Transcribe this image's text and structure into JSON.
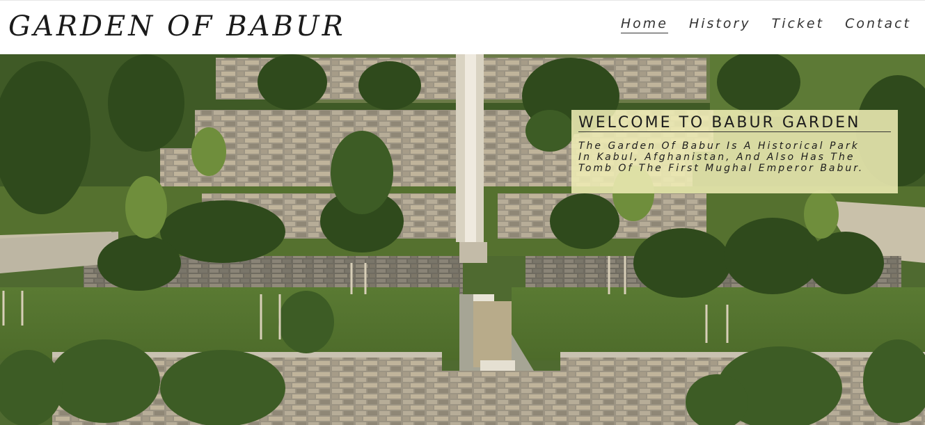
{
  "header": {
    "logo": "GARDEN OF BABUR",
    "nav": [
      {
        "label": "Home",
        "active": true
      },
      {
        "label": "History",
        "active": false
      },
      {
        "label": "Ticket",
        "active": false
      },
      {
        "label": "Contact",
        "active": false
      }
    ]
  },
  "hero": {
    "image": "garden-terraces-photo",
    "welcome": {
      "title": "WELCOME TO BABUR GARDEN",
      "text": "The Garden Of Babur Is A Historical Park In Kabul, Afghanistan, And Also Has The Tomb Of The First Mughal Emperor Babur."
    }
  },
  "colors": {
    "header_bg": "#ffffff",
    "text": "#1a1a1a",
    "welcome_bg": "#eeecb4"
  }
}
